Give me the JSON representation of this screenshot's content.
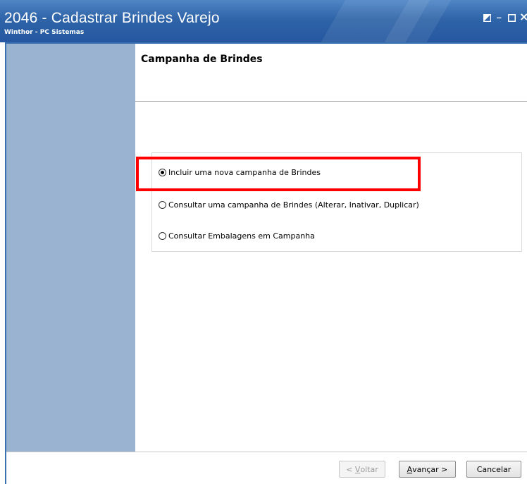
{
  "window": {
    "title": "2046 - Cadastrar Brindes Varejo",
    "subtitle": "Winthor - PC Sistemas",
    "controls": {
      "restore_icon": "restore-icon",
      "minimize_glyph": "_",
      "maximize_glyph": "☐",
      "close_glyph": "×"
    }
  },
  "header": {
    "title": "Campanha de Brindes"
  },
  "options": [
    {
      "label": "Incluir uma nova campanha de Brindes",
      "checked": true
    },
    {
      "label": "Consultar uma campanha de Brindes (Alterar, Inativar, Duplicar)",
      "checked": false
    },
    {
      "label": "Consultar Embalagens em Campanha",
      "checked": false
    }
  ],
  "buttons": {
    "back": {
      "mnemonic": "V",
      "rest": "oltar",
      "prefix": "< ",
      "suffix": "",
      "enabled": false
    },
    "next": {
      "mnemonic": "A",
      "rest": "vançar",
      "prefix": "",
      "suffix": " >",
      "enabled": true
    },
    "cancel": {
      "label": "Cancelar",
      "enabled": true
    }
  },
  "colors": {
    "titlebar": "#2f64a8",
    "sidebar": "#9ab3d1",
    "highlight": "#ff0000"
  }
}
